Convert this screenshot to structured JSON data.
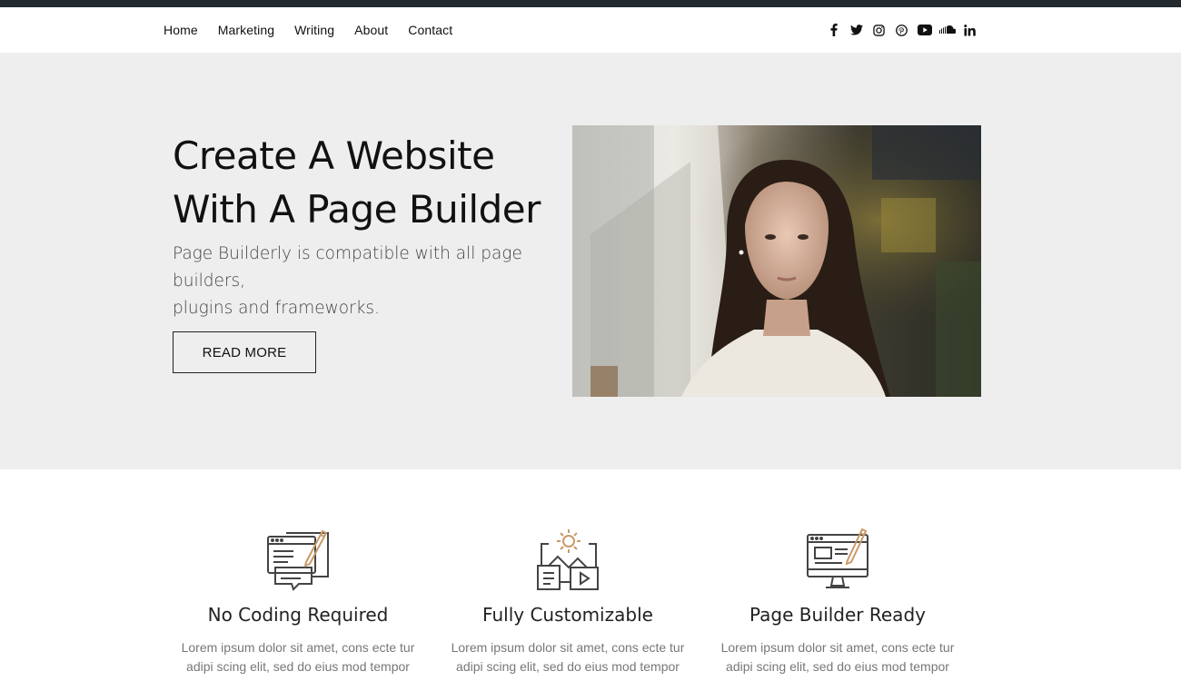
{
  "nav": {
    "items": [
      {
        "label": "Home"
      },
      {
        "label": "Marketing"
      },
      {
        "label": "Writing"
      },
      {
        "label": "About"
      },
      {
        "label": "Contact"
      }
    ]
  },
  "social": [
    "facebook-icon",
    "twitter-icon",
    "instagram-icon",
    "pinterest-icon",
    "youtube-icon",
    "soundcloud-icon",
    "linkedin-icon"
  ],
  "hero": {
    "title_line1": "Create A Website",
    "title_line2": "With A Page Builder",
    "subtitle_line1": "Page Builderly is compatible with all page builders,",
    "subtitle_line2": "plugins and frameworks.",
    "button_label": "READ MORE"
  },
  "features": [
    {
      "icon": "chat-document-pencil-icon",
      "title": "No Coding Required",
      "text_line1": "Lorem ipsum dolor sit amet, cons ecte tur",
      "text_line2": "adipi scing elit, sed do eius mod tempor inci"
    },
    {
      "icon": "gear-image-video-icon",
      "title": "Fully Customizable",
      "text_line1": "Lorem ipsum dolor sit amet, cons ecte tur",
      "text_line2": "adipi scing elit, sed do eius mod tempor inci"
    },
    {
      "icon": "monitor-pencil-icon",
      "title": "Page Builder Ready",
      "text_line1": "Lorem ipsum dolor sit amet, cons ecte tur",
      "text_line2": "adipi scing elit, sed do eius mod tempor inci"
    }
  ],
  "colors": {
    "topbar": "#222a2f",
    "hero_bg": "#eeeeee",
    "icon_stroke": "#444444",
    "icon_accent": "#c99a6a"
  }
}
